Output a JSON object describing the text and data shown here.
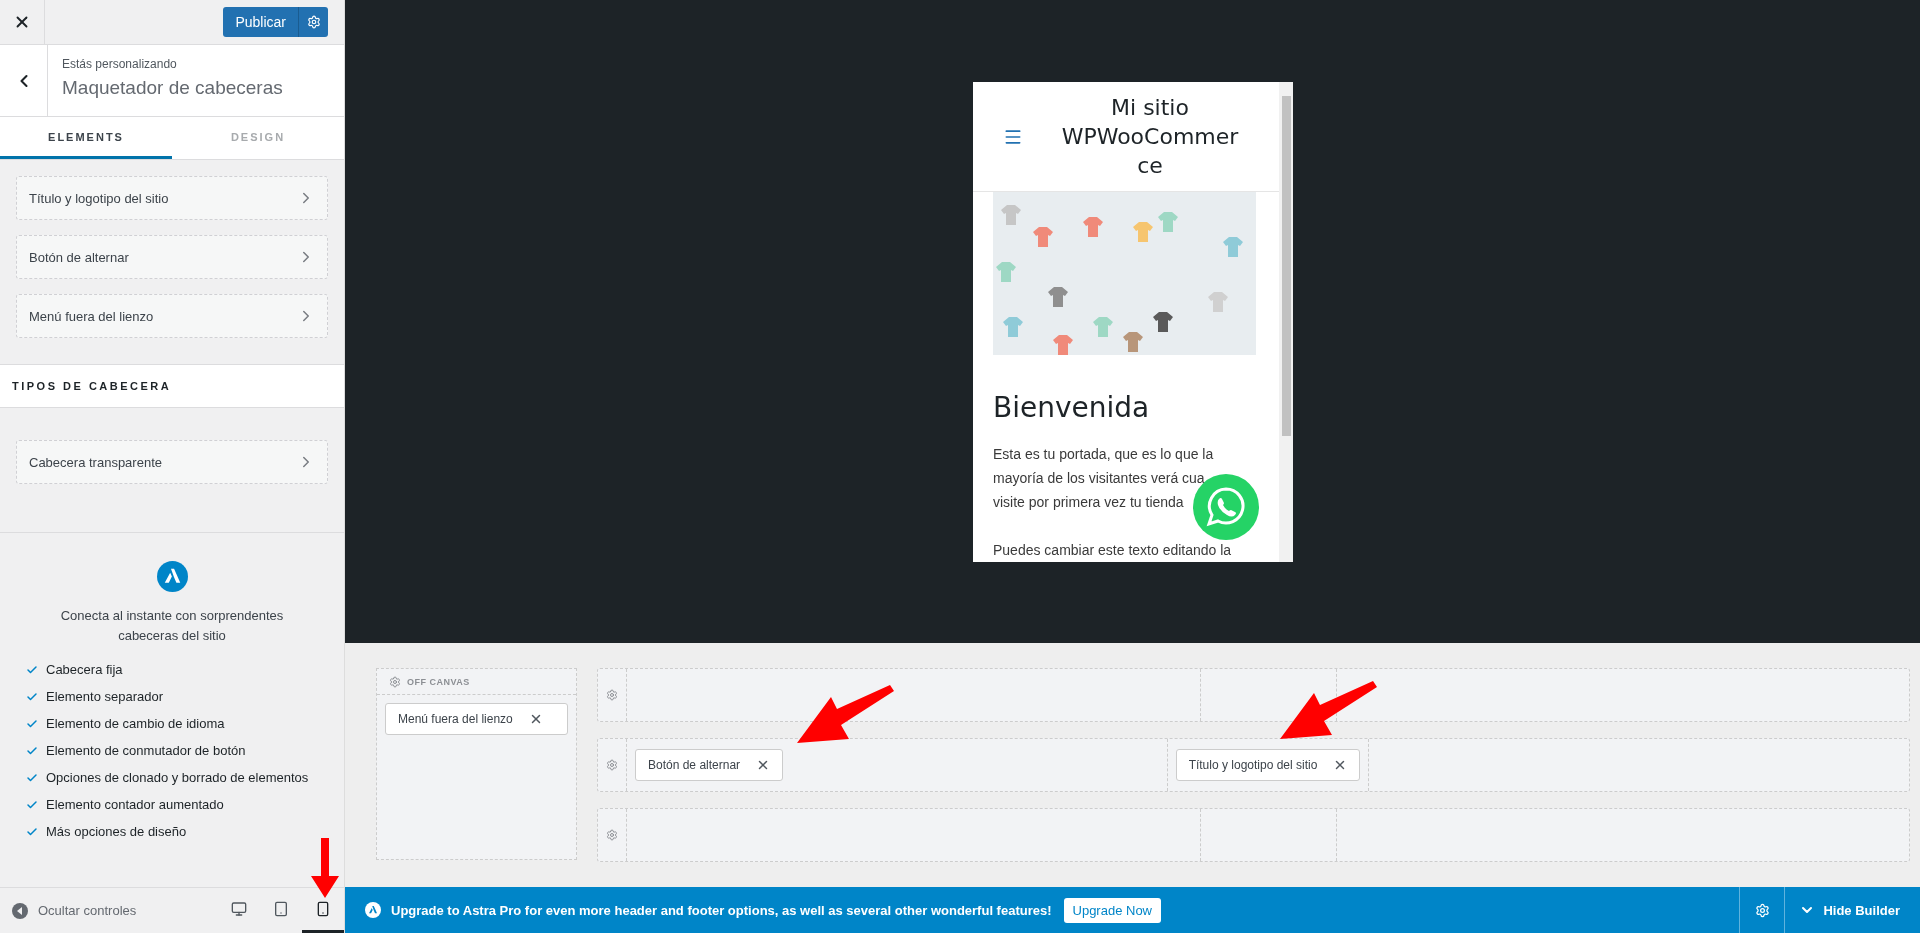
{
  "topbar": {
    "publish_label": "Publicar"
  },
  "header": {
    "subtitle": "Estás personalizando",
    "title": "Maquetador de cabeceras"
  },
  "tabs": [
    {
      "label": "ELEMENTS",
      "selected": true
    },
    {
      "label": "DESIGN",
      "selected": false
    }
  ],
  "elements": [
    "Título y logotipo del sitio",
    "Botón de alternar",
    "Menú fuera del lienzo"
  ],
  "section_title": "TIPOS DE CABECERA",
  "header_types": [
    "Cabecera transparente"
  ],
  "promo": {
    "text": "Conecta al instante con sorprendentes cabeceras del sitio",
    "features": [
      "Cabecera fija",
      "Elemento separador",
      "Elemento de cambio de idioma",
      "Elemento de conmutador de botón",
      "Opciones de clonado y borrado de elementos",
      "Elemento contador aumentado",
      "Más opciones de diseño"
    ]
  },
  "footer": {
    "hide_label": "Ocultar controles",
    "devices": [
      {
        "kind": "desktop",
        "selected": false
      },
      {
        "kind": "tablet",
        "selected": false
      },
      {
        "kind": "mobile",
        "selected": true
      }
    ]
  },
  "preview": {
    "site_title": "Mi sitio WPWooCommerce",
    "heading": "Bienvenida",
    "paragraph_lines": [
      "Esta es tu portada, que es lo que la",
      "mayoría de los visitantes verá cua",
      "visite por primera vez tu tienda"
    ],
    "next_line": "Puedes cambiar este texto editando la"
  },
  "builder": {
    "off_canvas": {
      "title": "OFF CANVAS",
      "items": [
        "Menú fuera del lienzo"
      ]
    },
    "rows": [
      {
        "columns": [
          [],
          [],
          []
        ]
      },
      {
        "columns": [
          [
            "Botón de alternar"
          ],
          [
            "Título y logotipo del sitio"
          ],
          []
        ]
      },
      {
        "columns": [
          [],
          [],
          []
        ]
      }
    ]
  },
  "bottom_bar": {
    "message": "Upgrade to Astra Pro for even more header and footer options, as well as several other wonderful features!",
    "upgrade_label": "Upgrade Now",
    "hide_label": "Hide Builder"
  }
}
